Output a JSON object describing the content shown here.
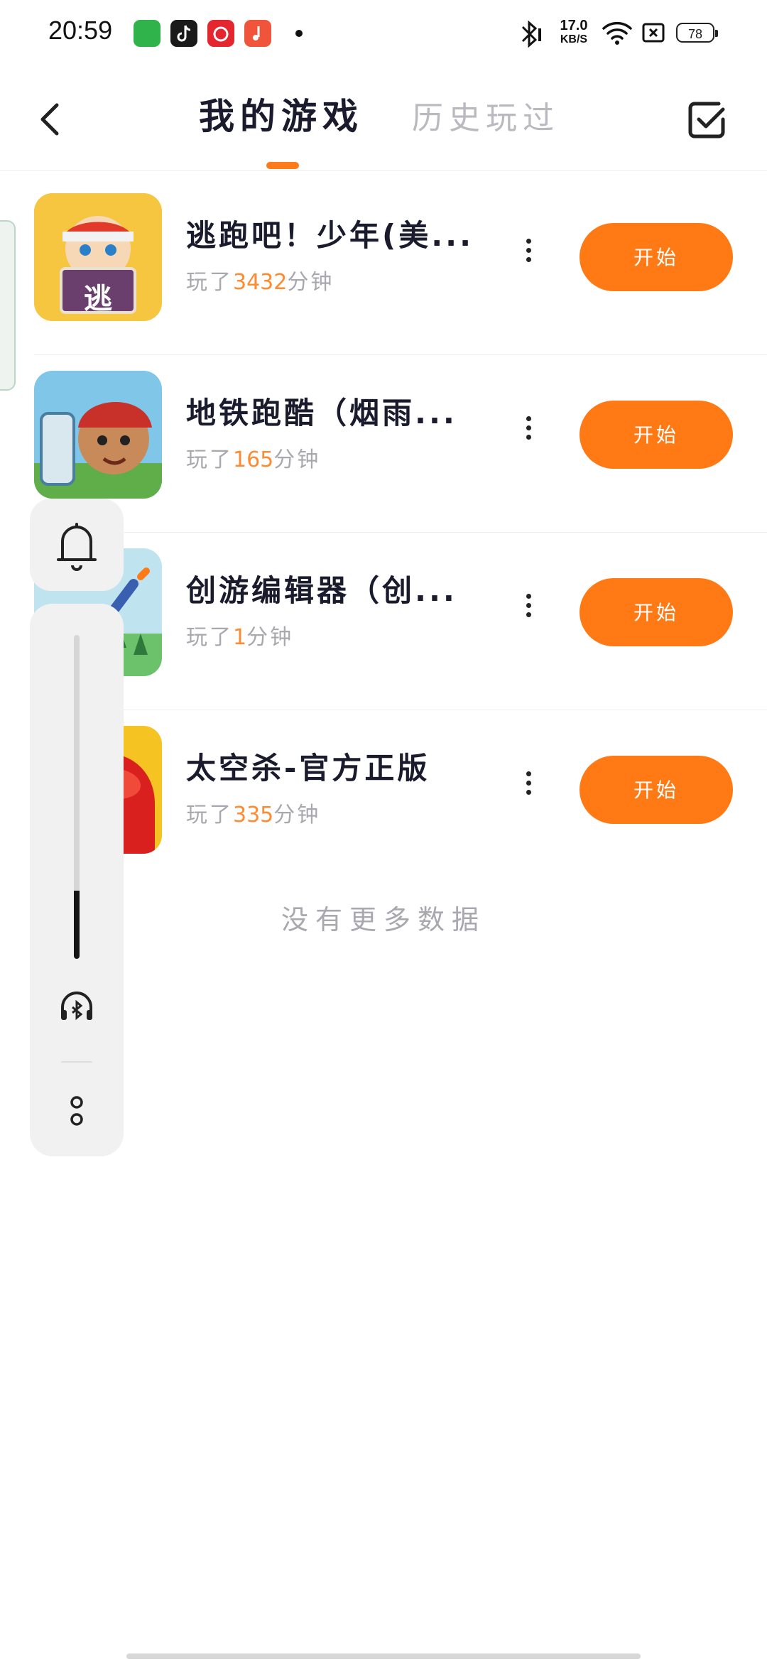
{
  "status_bar": {
    "time": "20:59",
    "net_speed_value": "17.0",
    "net_speed_unit": "KB/S",
    "battery": "78",
    "app_icons": [
      {
        "name": "app-store-icon",
        "color": "#2fb34a"
      },
      {
        "name": "douyin-icon",
        "color": "#1a1a1a"
      },
      {
        "name": "netease-music-icon",
        "color": "#e4262e"
      },
      {
        "name": "music-icon",
        "color": "#f0553c"
      }
    ]
  },
  "header": {
    "tab_active": "我的游戏",
    "tab_inactive": "历史玩过",
    "accent_color": "#ff7a1a"
  },
  "games": [
    {
      "name": "逃跑吧！少年(美...",
      "played_prefix": "玩了",
      "minutes": "3432",
      "played_suffix": "分钟",
      "button": "开始",
      "icon_label": "逃"
    },
    {
      "name": "地铁跑酷（烟雨...",
      "played_prefix": "玩了",
      "minutes": "165",
      "played_suffix": "分钟",
      "button": "开始"
    },
    {
      "name": "创游编辑器（创...",
      "played_prefix": "玩了",
      "minutes": "1",
      "played_suffix": "分钟",
      "button": "开始"
    },
    {
      "name": "太空杀-官方正版",
      "played_prefix": "玩了",
      "minutes": "335",
      "played_suffix": "分钟",
      "button": "开始"
    }
  ],
  "footer_text": "没有更多数据",
  "volume_panel": {
    "level_fraction": 0.21,
    "icons": [
      "bell-icon",
      "bluetooth-headset-icon",
      "more-options-icon"
    ]
  }
}
